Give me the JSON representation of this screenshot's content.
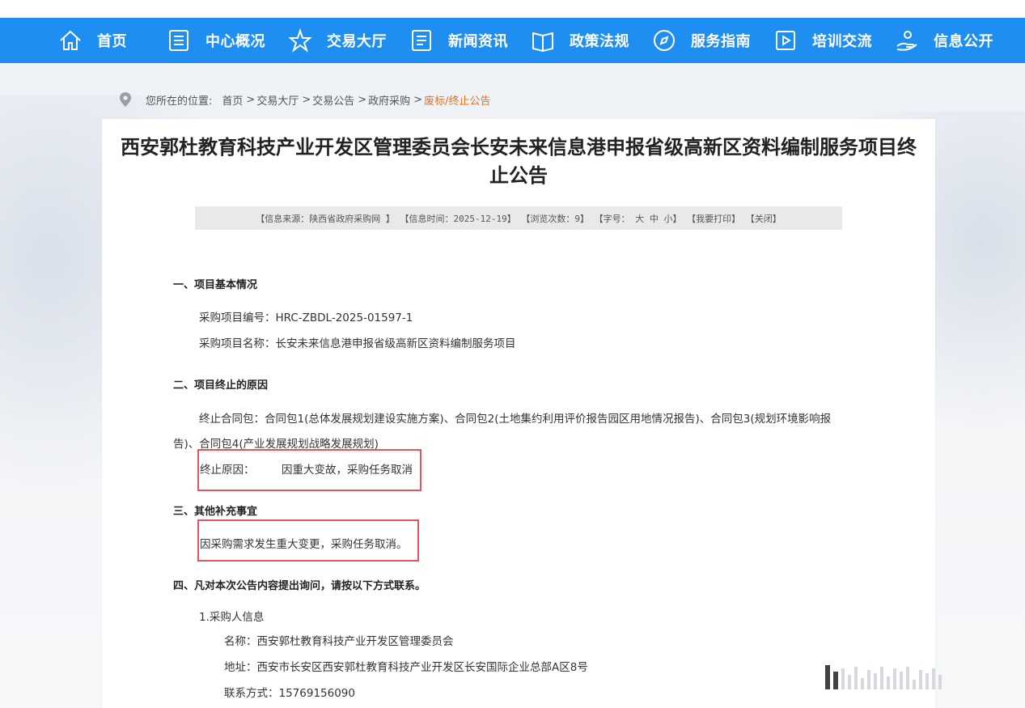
{
  "nav": {
    "items": [
      {
        "label": "首页",
        "icon": "home-icon"
      },
      {
        "label": "中心概况",
        "icon": "document-icon"
      },
      {
        "label": "交易大厅",
        "icon": "star-icon"
      },
      {
        "label": "新闻资讯",
        "icon": "news-icon"
      },
      {
        "label": "政策法规",
        "icon": "book-icon"
      },
      {
        "label": "服务指南",
        "icon": "compass-icon"
      },
      {
        "label": "培训交流",
        "icon": "play-icon"
      },
      {
        "label": "信息公开",
        "icon": "hand-icon"
      }
    ]
  },
  "breadcrumb": {
    "prefix": "您所在的位置:",
    "items": [
      "首页",
      "交易大厅",
      "交易公告",
      "政府采购"
    ],
    "current": "废标/终止公告"
  },
  "notice": {
    "title": "西安郭杜教育科技产业开发区管理委员会长安未来信息港申报省级高新区资料编制服务项目终止公告",
    "meta": {
      "source": "【信息来源：陕西省政府采购网 】",
      "time": "【信息时间：2025-12-19】",
      "views": "【浏览次数：9】",
      "font_size_label": "【字号：",
      "font_large": "大",
      "font_medium": "中",
      "font_small": "小",
      "font_close": "】",
      "print": "【我要打印】",
      "close": "【关闭】"
    },
    "section1": {
      "heading": "一、项目基本情况",
      "code_line": "采购项目编号：HRC-ZBDL-2025-01597-1",
      "name_line": "采购项目名称：长安未来信息港申报省级高新区资料编制服务项目"
    },
    "section2": {
      "heading": "二、项目终止的原因",
      "packages_line1": "终止合同包：合同包1(总体发展规划建设实施方案)、合同包2(土地集约利用评价报告园区用地情况报告)、合同包3(规划环境影响报",
      "packages_line2": "告)、合同包4(产业发展规划战略发展规划)",
      "reason_label": "终止原因：",
      "reason_value": "因重大变故，采购任务取消"
    },
    "section3": {
      "heading": "三、其他补充事宜",
      "text": "因采购需求发生重大变更，采购任务取消。"
    },
    "section4": {
      "heading": "四、凡对本次公告内容提出询问，请按以下方式联系。",
      "buyer_heading": "1.采购人信息",
      "name_line": "名称：西安郭杜教育科技产业开发区管理委员会",
      "address_line": "地址：西安市长安区西安郭杜教育科技产业开发区长安国际企业总部A区8号",
      "contact_line": "联系方式：15769156090"
    }
  },
  "colors": {
    "nav_bg": "#1e8ef0",
    "breadcrumb_current": "#e8701a",
    "highlight_box": "#e05560"
  }
}
